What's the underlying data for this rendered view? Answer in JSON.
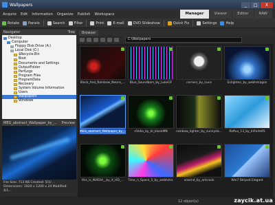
{
  "window": {
    "title": "Wallpapers",
    "minimize": "_",
    "maximize": "□",
    "close": "X"
  },
  "menu": [
    "Acquire",
    "Edit",
    "Information",
    "Organize",
    "Publish",
    "Workspace"
  ],
  "modes": [
    {
      "label": "Manager",
      "active": true
    },
    {
      "label": "Viewer",
      "active": false
    },
    {
      "label": "Editor",
      "active": false
    },
    {
      "label": "RAW",
      "active": false
    }
  ],
  "toolbar": [
    {
      "label": "Rotate",
      "icon": "rotate-icon",
      "color": "#6bbf4a"
    },
    {
      "label": "Panels",
      "icon": "panels-icon",
      "color": "#8aa0c0"
    },
    {
      "label": "Search",
      "icon": "search-icon",
      "color": "#d0d0d0"
    },
    {
      "label": "Filter",
      "icon": "filter-icon",
      "color": "#d0d0d0"
    },
    {
      "label": "Print",
      "icon": "print-icon",
      "color": "#d0d0d0"
    },
    {
      "label": "E-mail",
      "icon": "email-icon",
      "color": "#d0d0d0"
    },
    {
      "label": "DVD Slideshow",
      "icon": "dvd-icon",
      "color": "#d0d0d0"
    },
    {
      "label": "Quick Fix",
      "icon": "quickfix-icon",
      "color": "#e0a020"
    },
    {
      "label": "Settings",
      "icon": "settings-icon",
      "color": "#d0d0d0"
    },
    {
      "label": "Help",
      "icon": "help-icon",
      "color": "#3a8de0"
    }
  ],
  "navigator": {
    "title": "Navigator",
    "tree_label": "Tree",
    "items": [
      {
        "label": "Desktop",
        "type": "pc",
        "depth": 0
      },
      {
        "label": "Computer",
        "type": "pc",
        "depth": 1
      },
      {
        "label": "Floppy Disk Drive (A:)",
        "type": "drive",
        "depth": 2
      },
      {
        "label": "Local Disk (C:)",
        "type": "drive",
        "depth": 2
      },
      {
        "label": "$Recycle.Bin",
        "type": "folder",
        "depth": 3
      },
      {
        "label": "Boot",
        "type": "folder",
        "depth": 3
      },
      {
        "label": "Documents and Settings",
        "type": "folder",
        "depth": 3
      },
      {
        "label": "OutputFolder",
        "type": "folder",
        "depth": 3
      },
      {
        "label": "PerfLogs",
        "type": "folder",
        "depth": 3
      },
      {
        "label": "Program Files",
        "type": "folder",
        "depth": 3
      },
      {
        "label": "ProgramData",
        "type": "folder",
        "depth": 3
      },
      {
        "label": "Recovery",
        "type": "folder",
        "depth": 3
      },
      {
        "label": "System Volume Information",
        "type": "folder",
        "depth": 3
      },
      {
        "label": "Users",
        "type": "folder",
        "depth": 3
      },
      {
        "label": "Wallpapers",
        "type": "folder",
        "depth": 3,
        "selected": true
      },
      {
        "label": "Windows",
        "type": "folder",
        "depth": 3
      }
    ]
  },
  "preview": {
    "filename": "MEG_abstract_Wallpaper_by_...",
    "label": "Preview",
    "info": [
      "File Size: 713 KB    Created: 5/1/...",
      "Dimensions: 1920 x 1200 x 24    Modified: 4/1..."
    ]
  },
  "browser": {
    "tab": "Browser",
    "path": "C:\\Wallpapers",
    "items": [
      {
        "caption": "Black_And_Rainbow_Neons_...",
        "style": "t1"
      },
      {
        "caption": "Blue_Soundbars_by_LukeGF",
        "style": "t2"
      },
      {
        "caption": "corners_by_nuce",
        "style": "t3"
      },
      {
        "caption": "Enlighten_by_webhdragon",
        "style": "t4"
      },
      {
        "caption": "MEG_abstract_Wallpaper_by_...",
        "style": "t5",
        "selected": true
      },
      {
        "caption": "nVidia_by_bl_blackMN",
        "style": "t6"
      },
      {
        "caption": "rainbow_lighter_by_sunnyda...",
        "style": "t7"
      },
      {
        "caption": "Raftus_13_by_Infinite95",
        "style": "t8"
      },
      {
        "caption": "this_is_NVIDIA__by_X_HD_...",
        "style": "t9"
      },
      {
        "caption": "Time_n_Space_5_by_webhdra...",
        "style": "t10"
      },
      {
        "caption": "unwind_by_artcrack",
        "style": "t11"
      },
      {
        "caption": "Win7 Striped Elegant",
        "style": "t12"
      }
    ]
  },
  "status": {
    "count": "12 object(s)",
    "watermark": "zaycik.at.ua"
  }
}
